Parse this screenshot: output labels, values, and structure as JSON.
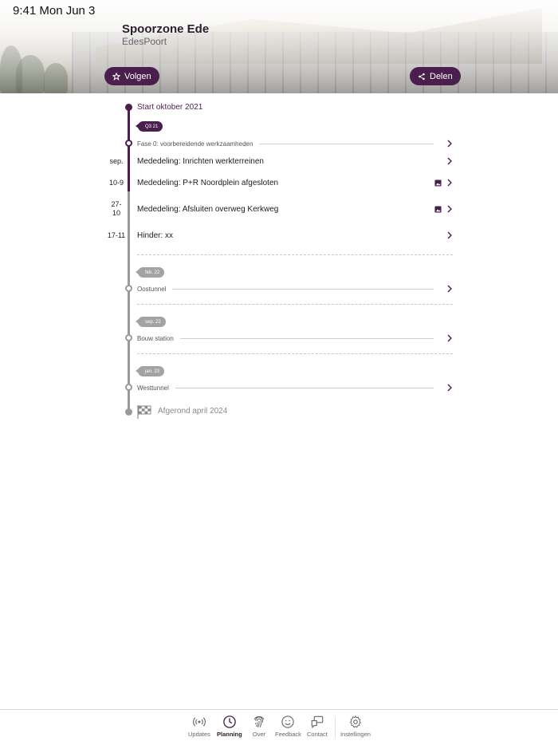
{
  "status_bar": {
    "time": "9:41  Mon Jun 3"
  },
  "header": {
    "title": "Spoorzone Ede",
    "subtitle": "EdesPoort",
    "follow_label": "Volgen",
    "share_label": "Delen"
  },
  "timeline": {
    "start_label": "Start oktober 2021",
    "q_tag": "Q3 21",
    "phase1": "Fase 0: voorbereidende werkzaamheden",
    "items": [
      {
        "date": "sep.",
        "label": "Mededeling: Inrichten werkterreinen",
        "has_image": false
      },
      {
        "date": "10-9",
        "label": "Mededeling: P+R Noordplein afgesloten",
        "has_image": true
      },
      {
        "date": "27-\n10",
        "label": "Mededeling: Afsluiten overweg Kerkweg",
        "has_image": true
      },
      {
        "date": "17-11",
        "label": "Hinder: xx",
        "has_image": false
      }
    ],
    "tag_feb": "feb. 22",
    "phase_oostunnel": "Oostunnel",
    "tag_sep": "sep. 22",
    "phase_bouw": "Bouw station",
    "tag_jan": "jan. 23",
    "phase_westtunnel": "Westtunnel",
    "end_label": "Afgerond april 2024"
  },
  "tabbar": {
    "updates": "Updates",
    "planning": "Planning",
    "over": "Over",
    "feedback": "Feedback",
    "contact": "Contact",
    "instellingen": "Instellingen"
  },
  "colors": {
    "accent": "#4b1f4d",
    "muted": "#9a9a9a"
  }
}
